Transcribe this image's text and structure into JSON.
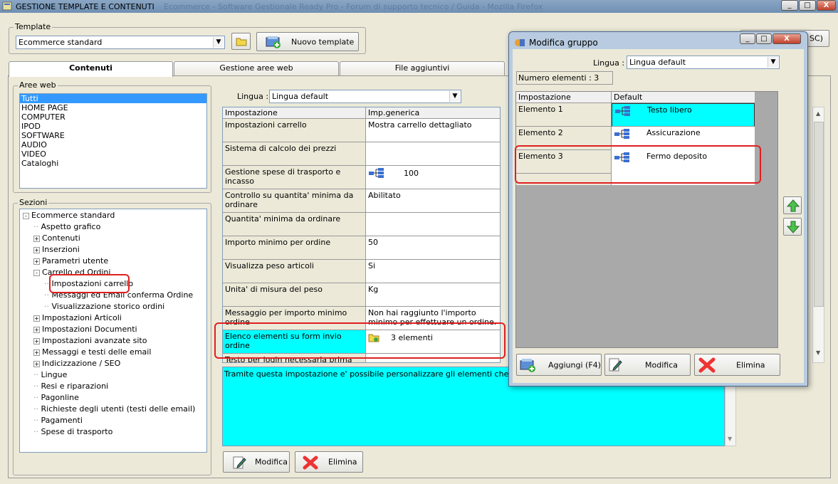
{
  "window": {
    "title": "GESTIONE TEMPLATE E CONTENUTI",
    "bg_title": "Ecommerce - Software Gestionale Ready Pro - Forum di supporto tecnico / Guida - Mozilla Firefox",
    "min": "_",
    "max": "□",
    "close": "X"
  },
  "template": {
    "group_label": "Template",
    "selected": "Ecommerce standard",
    "new_button": "Nuovo template"
  },
  "tabs": [
    "Contenuti",
    "Gestione aree web",
    "File aggiuntivi"
  ],
  "aree": {
    "label": "Aree web",
    "items": [
      "Tutti",
      "HOME PAGE",
      "COMPUTER",
      "IPOD",
      "SOFTWARE",
      "AUDIO",
      "VIDEO",
      "Cataloghi"
    ]
  },
  "sezioni": {
    "label": "Sezioni",
    "items": [
      {
        "text": "Ecommerce standard",
        "exp": "-"
      },
      {
        "text": "Aspetto grafico",
        "exp": ""
      },
      {
        "text": "Contenuti",
        "exp": "+"
      },
      {
        "text": "Inserzioni",
        "exp": "+"
      },
      {
        "text": "Parametri utente",
        "exp": "+"
      },
      {
        "text": "Carrello ed Ordini",
        "exp": "-"
      },
      {
        "text": "Impostazioni carrello",
        "exp": ""
      },
      {
        "text": "Messaggi ed Email conferma Ordine",
        "exp": ""
      },
      {
        "text": "Visualizzazione storico ordini",
        "exp": ""
      },
      {
        "text": "Impostazioni Articoli",
        "exp": "+"
      },
      {
        "text": "Impostazioni Documenti",
        "exp": "+"
      },
      {
        "text": "Impostazioni avanzate sito",
        "exp": "+"
      },
      {
        "text": "Messaggi e testi delle email",
        "exp": "+"
      },
      {
        "text": "Indicizzazione / SEO",
        "exp": "+"
      },
      {
        "text": "Lingue",
        "exp": ""
      },
      {
        "text": "Resi e riparazioni",
        "exp": ""
      },
      {
        "text": "Pagonline",
        "exp": ""
      },
      {
        "text": "Richieste degli utenti (testi delle email)",
        "exp": ""
      },
      {
        "text": "Pagamenti",
        "exp": ""
      },
      {
        "text": "Spese di trasporto",
        "exp": ""
      }
    ]
  },
  "main": {
    "lingua_label": "Lingua :",
    "lingua_value": "Lingua default",
    "col_impostazione": "Impostazione",
    "col_generica": "Imp.generica",
    "rows": [
      {
        "name": "Impostazioni carrello",
        "value": "Mostra carrello dettagliato"
      },
      {
        "name": "Sistema di calcolo dei prezzi",
        "value": ""
      },
      {
        "name": "Gestione spese di trasporto e incasso",
        "value": "100"
      },
      {
        "name": "Controllo su quantita' minima da ordinare",
        "value": "Abilitato"
      },
      {
        "name": "Quantita' minima da ordinare",
        "value": ""
      },
      {
        "name": "Importo minimo per ordine",
        "value": "50"
      },
      {
        "name": "Visualizza peso articoli",
        "value": "Si"
      },
      {
        "name": "Unita' di misura del peso",
        "value": "Kg"
      },
      {
        "name": "Messaggio per importo minimo ordine",
        "value": "Non hai raggiunto l'importo minimo per effettuare un ordine."
      },
      {
        "name": "Elenco elementi su form invio ordine",
        "value": "3 elementi"
      },
      {
        "name": "Testo per login necessaria prima",
        "value": ""
      }
    ],
    "description": "Tramite questa impostazione e' possibile personalizzare gli elementi che compongono",
    "modifica": "Modifica",
    "elimina": "Elimina"
  },
  "dialog": {
    "title": "Modifica gruppo",
    "lingua_label": "Lingua :",
    "lingua_value": "Lingua default",
    "count": "Numero elementi : 3",
    "col_impostazione": "Impostazione",
    "col_default": "Default",
    "rows": [
      {
        "name": "Elemento 1",
        "value": "Testo libero"
      },
      {
        "name": "Elemento 2",
        "value": "Assicurazione"
      },
      {
        "name": "Elemento 3",
        "value": "Fermo deposito"
      }
    ],
    "aggiungi": "Aggiungi (F4)",
    "modifica": "Modifica",
    "elimina": "Elimina"
  },
  "right_partial": "SC)",
  "colors": {
    "highlight": "#00ffff",
    "selection": "#3399ff",
    "red": "#e02020"
  }
}
